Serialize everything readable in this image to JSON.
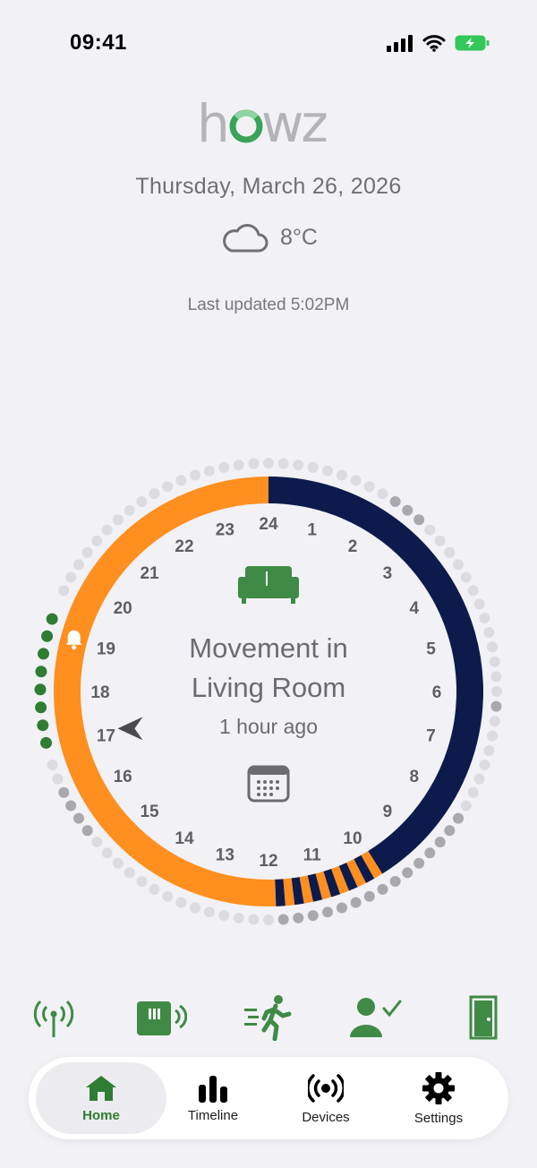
{
  "status": {
    "time": "09:41"
  },
  "header": {
    "logo_text": "howz",
    "date": "Thursday, March 26, 2026",
    "temperature": "8°C",
    "weather_icon": "cloud-icon",
    "last_updated": "Last updated 5:02PM"
  },
  "activity": {
    "title_line1": "Movement in",
    "title_line2": "Living Room",
    "time_ago": "1 hour ago",
    "room_icon": "sofa-icon",
    "calendar_icon": "calendar-icon",
    "hours": [
      "24",
      "1",
      "2",
      "3",
      "4",
      "5",
      "6",
      "7",
      "8",
      "9",
      "10",
      "11",
      "12",
      "13",
      "14",
      "15",
      "16",
      "17",
      "18",
      "19",
      "20",
      "21",
      "22",
      "23"
    ],
    "colors": {
      "day": "#ff8f1f",
      "night": "#0d1b4c",
      "accent": "#2e7d32"
    }
  },
  "devices": [
    {
      "icon": "hub-signal-icon"
    },
    {
      "icon": "plug-sensor-icon"
    },
    {
      "icon": "motion-sensor-icon"
    },
    {
      "icon": "person-check-icon"
    },
    {
      "icon": "door-sensor-icon"
    }
  ],
  "tabs": [
    {
      "label": "Home",
      "icon": "home-icon"
    },
    {
      "label": "Timeline",
      "icon": "bar-chart-icon"
    },
    {
      "label": "Devices",
      "icon": "broadcast-icon"
    },
    {
      "label": "Settings",
      "icon": "gear-icon"
    }
  ]
}
